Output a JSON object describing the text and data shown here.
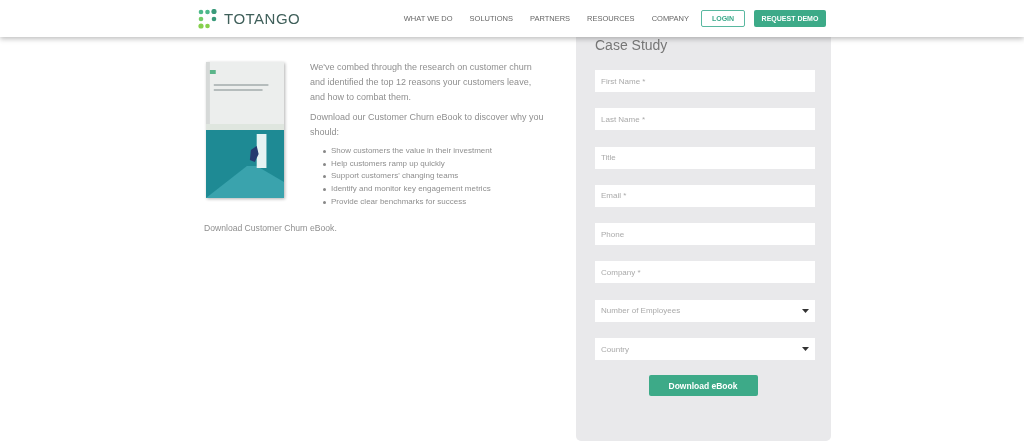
{
  "header": {
    "brand": "TOTANGO",
    "nav": [
      {
        "label": "WHAT WE DO"
      },
      {
        "label": "SOLUTIONS"
      },
      {
        "label": "PARTNERS"
      },
      {
        "label": "RESOURCES"
      },
      {
        "label": "COMPANY"
      }
    ],
    "login": "LOGIN",
    "cta": "REQUEST DEMO"
  },
  "intro": {
    "paragraphs": [
      "We've combed through the research on customer churn and identified the top 12 reasons your customers leave, and how to combat them.",
      "Download our Customer Churn eBook to discover why you should:"
    ],
    "bullets": [
      "Show customers the value in their investment",
      "Help customers ramp up quickly",
      "Support customers' changing teams",
      "Identify and monitor key engagement metrics",
      "Provide clear benchmarks for success"
    ],
    "footer": "Download Customer Churn eBook."
  },
  "form": {
    "title": "Case Study",
    "fields": [
      {
        "kind": "text",
        "placeholder": "First Name *"
      },
      {
        "kind": "text",
        "placeholder": "Last Name *"
      },
      {
        "kind": "text",
        "placeholder": "Title"
      },
      {
        "kind": "text",
        "placeholder": "Email *"
      },
      {
        "kind": "text",
        "placeholder": "Phone"
      },
      {
        "kind": "text",
        "placeholder": "Company *"
      },
      {
        "kind": "select",
        "placeholder": "Number of Employees"
      },
      {
        "kind": "select",
        "placeholder": "Country"
      }
    ],
    "submit": "Download eBook"
  }
}
